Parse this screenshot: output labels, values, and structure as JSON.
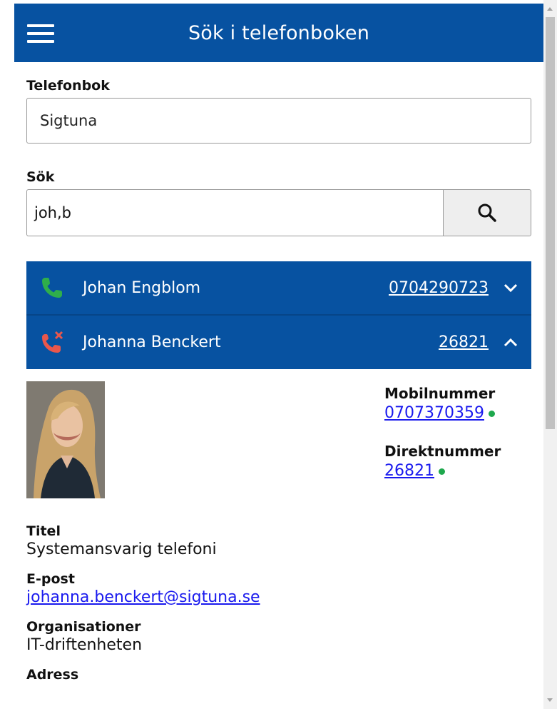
{
  "header": {
    "title": "Sök i telefonboken",
    "menu_icon": "hamburger-icon"
  },
  "phonebook": {
    "label": "Telefonbok",
    "selected": "Sigtuna"
  },
  "search": {
    "label": "Sök",
    "value": "joh,b",
    "button_icon": "search-icon"
  },
  "results": [
    {
      "name": "Johan Engblom",
      "number": "0704290723",
      "status_icon": "phone-icon",
      "status_color": "#2fae4b",
      "expanded": false
    },
    {
      "name": "Johanna Benckert",
      "number": "26821",
      "status_icon": "phone-missed-icon",
      "status_color": "#e9574c",
      "expanded": true
    }
  ],
  "details": {
    "mobile_label": "Mobilnummer",
    "mobile": "0707370359",
    "direct_label": "Direktnummer",
    "direct": "26821",
    "title_label": "Titel",
    "title": "Systemansvarig telefoni",
    "email_label": "E-post",
    "email": "johanna.benckert@sigtuna.se",
    "org_label": "Organisationer",
    "org": "IT-driftenheten",
    "address_label": "Adress"
  },
  "colors": {
    "primary": "#0752a1",
    "available": "#1ea84d",
    "link": "#1a1aee"
  }
}
